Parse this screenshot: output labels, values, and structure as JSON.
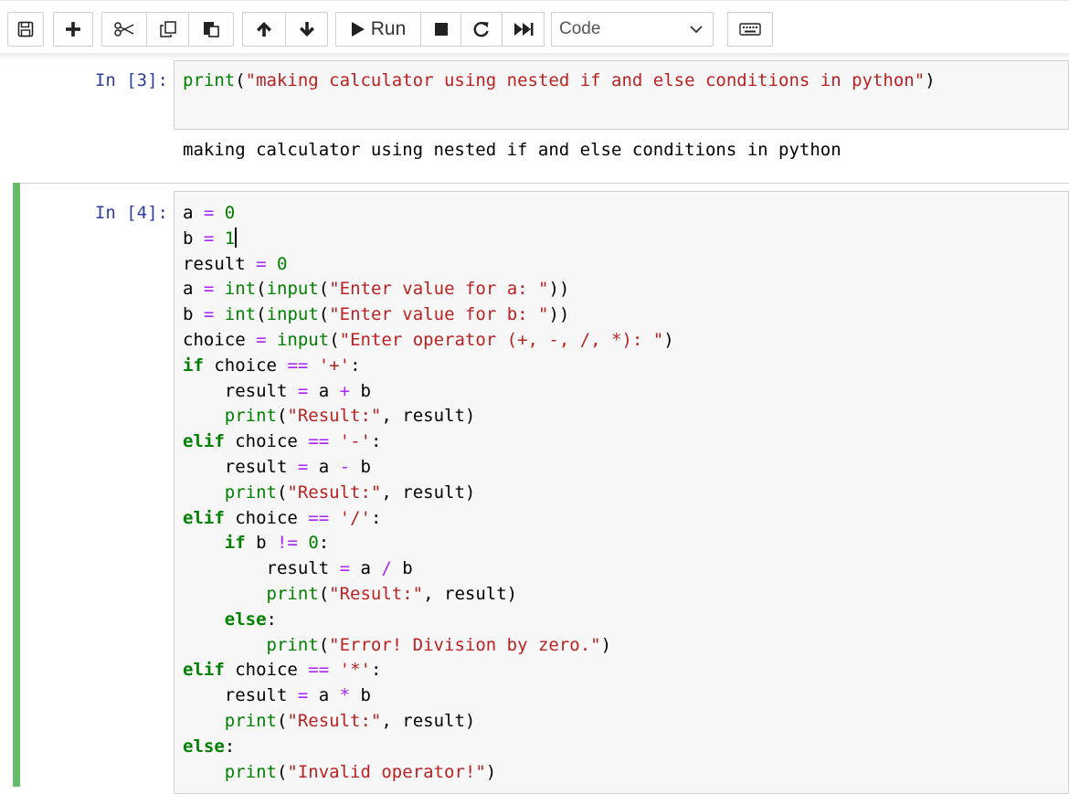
{
  "toolbar": {
    "buttons": [
      {
        "icon": "save-icon"
      },
      {
        "icon": "plus-icon"
      },
      {
        "icon": "cut-icon"
      },
      {
        "icon": "copy-icon"
      },
      {
        "icon": "paste-icon"
      },
      {
        "icon": "arrow-up-icon"
      },
      {
        "icon": "arrow-down-icon"
      },
      {
        "icon": "run-icon",
        "label": "Run"
      },
      {
        "icon": "stop-icon"
      },
      {
        "icon": "restart-icon"
      },
      {
        "icon": "fast-forward-icon"
      },
      {
        "icon": "keyboard-icon"
      }
    ],
    "run_label": "Run",
    "cell_type": "Code"
  },
  "cells": [
    {
      "prompt": "In [3]:",
      "source": "print(\"making calculator using nested if and else conditions in python\")",
      "output": "making calculator using nested if and else conditions in python"
    },
    {
      "prompt": "In [4]:",
      "source_lines": [
        "a = 0",
        "b = 1",
        "result = 0",
        "a = int(input(\"Enter value for a: \"))",
        "b = int(input(\"Enter value for b: \"))",
        "choice = input(\"Enter operator (+, -, /, *): \")",
        "if choice == '+':",
        "    result = a + b",
        "    print(\"Result:\", result)",
        "elif choice == '-':",
        "    result = a - b",
        "    print(\"Result:\", result)",
        "elif choice == '/':",
        "    if b != 0:",
        "        result = a / b",
        "        print(\"Result:\", result)",
        "    else:",
        "        print(\"Error! Division by zero.\")",
        "elif choice == '*':",
        "    result = a * b",
        "    print(\"Result:\", result)",
        "else:",
        "    print(\"Invalid operator!\")"
      ]
    }
  ],
  "colors": {
    "prompt": "#303f9f",
    "keyword": "#008000",
    "string": "#ba2121",
    "operator": "#aa22ff",
    "selected_cell_bar": "#66bb6a",
    "input_background": "#f7f7f7"
  }
}
